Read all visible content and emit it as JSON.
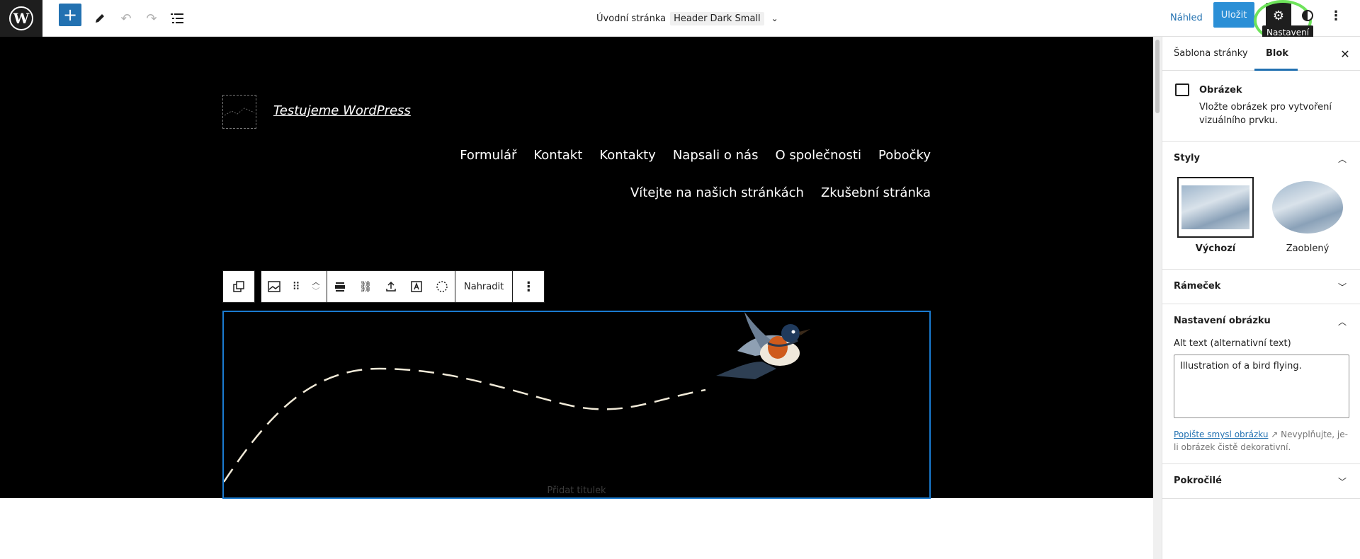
{
  "topbar": {
    "doc_title": "Úvodní stránka",
    "template_tag": "Header Dark Small",
    "preview_label": "Náhled",
    "save_label": "Uložit",
    "settings_tooltip": "Nastavení"
  },
  "site": {
    "title": "Testujeme WordPress",
    "nav": [
      "Formulář",
      "Kontakt",
      "Kontakty",
      "Napsali o nás",
      "O společnosti",
      "Pobočky",
      "Vítejte na našich stránkách",
      "Zkušební stránka"
    ]
  },
  "block_toolbar": {
    "replace_label": "Nahradit"
  },
  "image_block": {
    "caption_placeholder": "Přidat titulek"
  },
  "sidebar": {
    "tabs": [
      "Šablona stránky",
      "Blok"
    ],
    "active_tab": "Blok",
    "block": {
      "name": "Obrázek",
      "description": "Vložte obrázek pro vytvoření vizuálního prvku."
    },
    "panels": {
      "styles": {
        "title": "Styly",
        "options": [
          {
            "label": "Výchozí"
          },
          {
            "label": "Zaoblený"
          }
        ]
      },
      "border": {
        "title": "Rámeček"
      },
      "image_settings": {
        "title": "Nastavení obrázku",
        "alt_label": "Alt text (alternativní text)",
        "alt_value": "Illustration of a bird flying.",
        "help_link": "Popište smysl obrázku",
        "help_text": "Nevyplňujte, je-li obrázek čistě dekorativní."
      },
      "advanced": {
        "title": "Pokročilé"
      }
    }
  },
  "colors": {
    "accent": "#2271b1",
    "highlight": "#6ee35b",
    "canvas_bg": "#000000"
  }
}
